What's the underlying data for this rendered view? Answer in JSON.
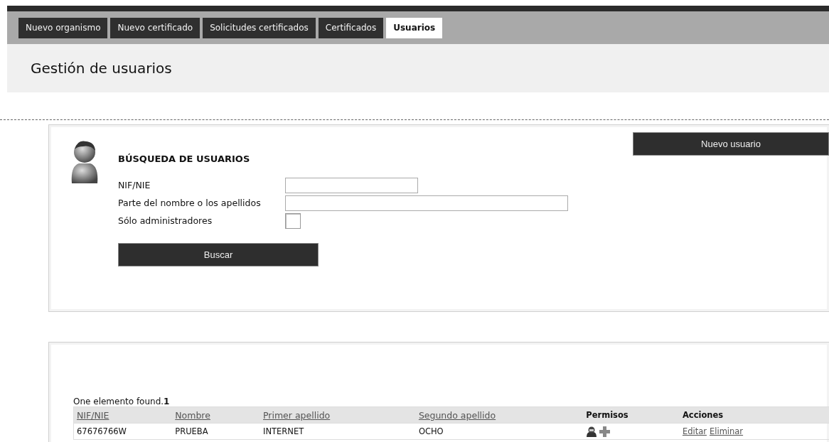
{
  "tabs": [
    {
      "label": "Nuevo organismo",
      "selected": false
    },
    {
      "label": "Nuevo certificado",
      "selected": false
    },
    {
      "label": "Solicitudes certificados",
      "selected": false
    },
    {
      "label": "Certificados",
      "selected": false
    },
    {
      "label": "Usuarios",
      "selected": true
    }
  ],
  "page_title": "Gestión de usuarios",
  "search": {
    "title": "BÚSQUEDA DE USUARIOS",
    "new_button": "Nuevo usuario",
    "fields": [
      {
        "kind": "text",
        "label": "NIF/NIE",
        "wide": false
      },
      {
        "kind": "text",
        "label": "Parte del nombre o los apellidos",
        "wide": true
      },
      {
        "kind": "checkbox",
        "label": "Sólo administradores",
        "checked": false
      }
    ],
    "submit": "Buscar"
  },
  "results": {
    "summary": "One elemento found.",
    "count": "1",
    "columns": [
      {
        "label": "NIF/NIE",
        "sortable": true
      },
      {
        "label": "Nombre",
        "sortable": true
      },
      {
        "label": "Primer apellido",
        "sortable": true
      },
      {
        "label": "Segundo apellido",
        "sortable": true
      },
      {
        "label": "Permisos",
        "sortable": false
      },
      {
        "label": "Acciones",
        "sortable": false
      }
    ],
    "rows": [
      {
        "nif": "67676766W",
        "nombre": "PRUEBA",
        "primer_apellido": "INTERNET",
        "segundo_apellido": "OCHO",
        "actions": [
          "Editar",
          "Eliminar"
        ]
      }
    ]
  }
}
